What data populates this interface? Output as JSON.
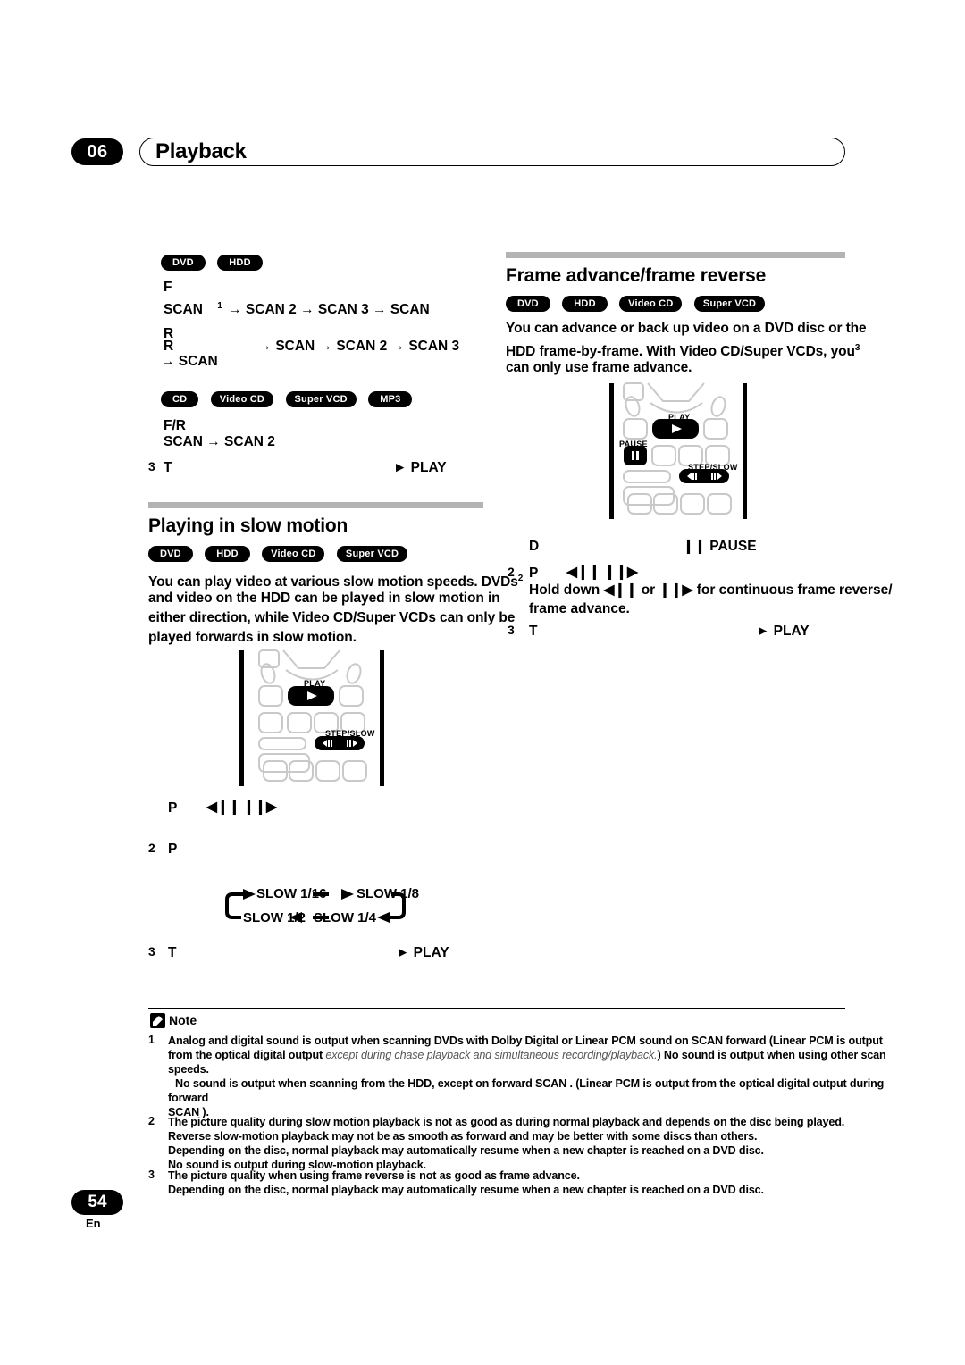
{
  "page": {
    "chapter_number": "06",
    "chapter_title": "Playback",
    "page_number": "54",
    "language_code": "En"
  },
  "left_column": {
    "scan_block": {
      "badges": [
        "DVD",
        "HDD"
      ],
      "line1": "F",
      "line2_prefix": "SCAN",
      "line2_sup": "1",
      "line2_rest": "→ SCAN 2  → SCAN 3  → SCAN",
      "line3": "R",
      "line4_prefix": "R",
      "line4_rest": "→ SCAN    → SCAN 2 → SCAN 3",
      "line5": "→ SCAN"
    },
    "scan_block2": {
      "badges": [
        "CD",
        "Video CD",
        "Super VCD",
        "MP3"
      ],
      "line1": "F/R",
      "line2": "SCAN    → SCAN 2"
    },
    "scan_step3": {
      "number": "3",
      "label": "T",
      "action": "► PLAY"
    },
    "slow_motion": {
      "heading": "Playing in slow motion",
      "badges": [
        "DVD",
        "HDD",
        "Video CD",
        "Super VCD"
      ],
      "intro_line1": "You can play video at various slow motion speeds. DVDs",
      "intro_line1_sup": "2",
      "intro_line2": "and video on the HDD can be played in slow motion in",
      "intro_line3": "either direction, while Video CD/Super VCDs can only be",
      "intro_line4": "played forwards in slow motion.",
      "remote_labels": {
        "play": "PLAY",
        "step_slow": "STEP/SLOW"
      },
      "step1": {
        "label": "P",
        "icon_reverse": "◀❙❙",
        "icon_forward": "❙❙▶"
      },
      "step2": {
        "number": "2",
        "label": "P"
      },
      "speed_loop": [
        "SLOW 1/16",
        "SLOW 1/8",
        "SLOW 1/4",
        "SLOW 1/2"
      ],
      "step3": {
        "number": "3",
        "label": "T",
        "action": "► PLAY"
      }
    }
  },
  "right_column": {
    "frame_advance": {
      "heading": "Frame advance/frame reverse",
      "badges": [
        "DVD",
        "HDD",
        "Video CD",
        "Super VCD"
      ],
      "intro_line1": "You can advance or back up video on a DVD disc or the",
      "intro_line2": "HDD frame-by-frame. With Video CD/Super VCDs, you",
      "intro_line2_sup": "3",
      "intro_line3": "can only use frame advance.",
      "remote_labels": {
        "play": "PLAY",
        "pause": "PAUSE",
        "step_slow": "STEP/SLOW"
      },
      "step1": {
        "label": "D",
        "action": "❙❙ PAUSE"
      },
      "step2": {
        "number": "2",
        "label": "P",
        "icon_reverse": "◀❙❙",
        "icon_forward": "❙❙▶",
        "hold_line1": "Hold down ◀❙❙ or ❙❙▶ for continuous frame reverse/",
        "hold_line2": "frame advance."
      },
      "step3": {
        "number": "3",
        "label": "T",
        "action": "► PLAY"
      }
    }
  },
  "notes": {
    "label": "Note",
    "items": [
      {
        "number": "1",
        "lines": [
          "Analog and digital sound is output when scanning DVDs with Dolby Digital or Linear PCM sound on SCAN forward (Linear PCM is output",
          "from the optical digital output except during chase playback and simultaneous recording/playback.) No sound is output when using other scan",
          "speeds.",
          "No sound is output when scanning from the HDD, except on forward SCAN . (Linear PCM is output from the optical digital output during",
          "forward",
          "SCAN )."
        ]
      },
      {
        "number": "2",
        "lines": [
          "The picture quality during slow motion playback is not as good as during normal playback and depends on the disc being played.",
          "Reverse slow-motion playback may not be as smooth as forward and may be better with some discs than others.",
          "Depending on the disc, normal playback may automatically resume when a new chapter is reached on a DVD disc.",
          "No sound is output during slow-motion playback."
        ]
      },
      {
        "number": "3",
        "lines": [
          "The picture quality when using frame reverse is not as good as frame advance.",
          "Depending on the disc, normal playback may automatically resume when a new chapter is reached on a DVD disc."
        ]
      }
    ]
  },
  "colors": {
    "ink": "#000000",
    "rule": "#b3b3b3",
    "remote_outline": "#c9c9c9"
  }
}
